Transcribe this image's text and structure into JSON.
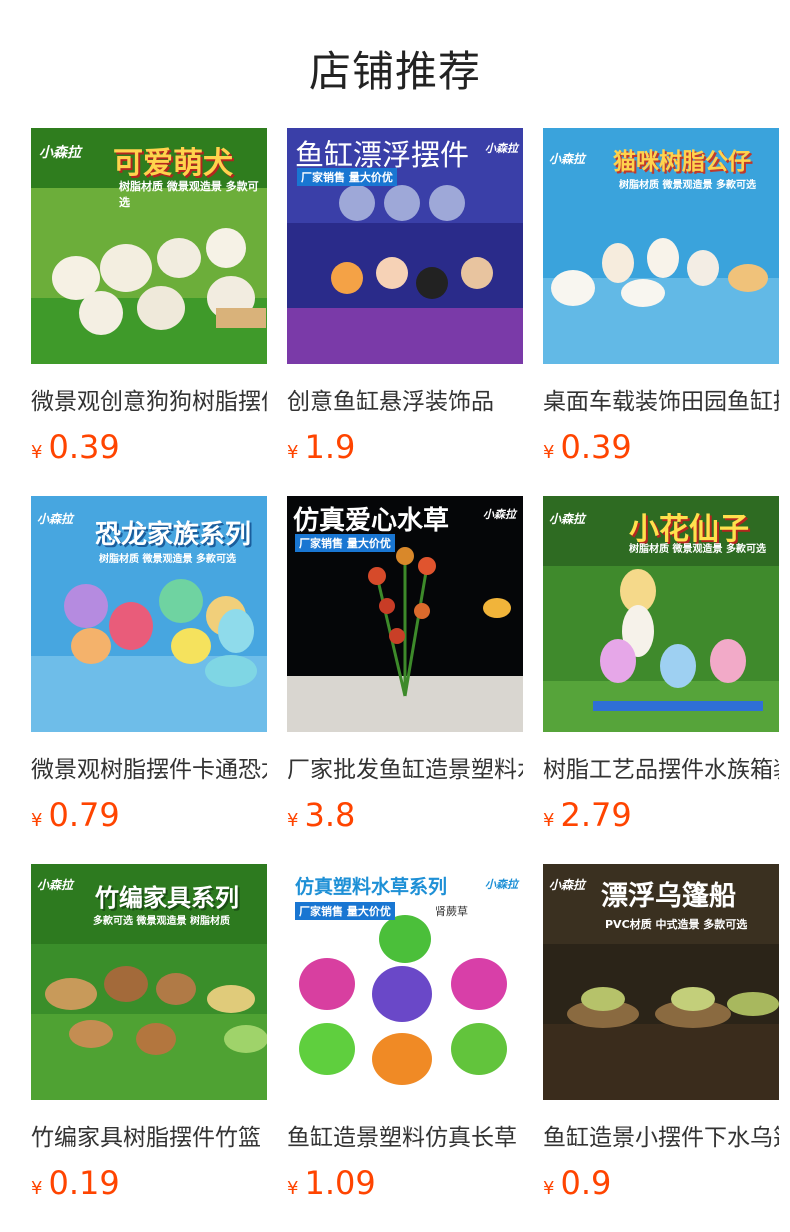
{
  "section_title": "店铺推荐",
  "currency": "¥",
  "products": [
    {
      "name": "微景观创意狗狗树脂摆件",
      "price": "0.39",
      "banner": "可爱萌犬",
      "sub": "树脂材质 微景观造景 多款可选",
      "brand": "小森拉"
    },
    {
      "name": "创意鱼缸悬浮装饰品",
      "price": "1.9",
      "banner": "鱼缸漂浮摆件",
      "sub": "厂家销售 量大价优",
      "brand": "小森拉"
    },
    {
      "name": "桌面车载装饰田园鱼缸摆件",
      "price": "0.39",
      "banner": "猫咪树脂公仔",
      "sub": "树脂材质 微景观造景 多款可选",
      "brand": "小森拉"
    },
    {
      "name": "微景观树脂摆件卡通恐龙",
      "price": "0.79",
      "banner": "恐龙家族系列",
      "sub": "树脂材质 微景观造景 多款可选",
      "brand": "小森拉"
    },
    {
      "name": "厂家批发鱼缸造景塑料水草",
      "price": "3.8",
      "banner": "仿真爱心水草",
      "sub": "厂家销售 量大价优",
      "brand": "小森拉"
    },
    {
      "name": "树脂工艺品摆件水族箱装饰",
      "price": "2.79",
      "banner": "小花仙子",
      "sub": "树脂材质 微景观造景 多款可选",
      "brand": "小森拉"
    },
    {
      "name": "竹编家具树脂摆件竹篮",
      "price": "0.19",
      "banner": "竹编家具系列",
      "sub": "多款可选 微景观造景 树脂材质",
      "brand": "小森拉"
    },
    {
      "name": "鱼缸造景塑料仿真长草",
      "price": "1.09",
      "banner": "仿真塑料水草系列",
      "sub": "厂家销售 量大价优",
      "extra": "肾蕨草",
      "brand": "小森拉"
    },
    {
      "name": "鱼缸造景小摆件下水乌篷船",
      "price": "0.9",
      "banner": "漂浮乌篷船",
      "sub": "PVC材质 中式造景 多款可选",
      "brand": "小森拉"
    }
  ],
  "colors": {
    "price": "#ff4400",
    "title": "#222222",
    "name": "#333333"
  }
}
